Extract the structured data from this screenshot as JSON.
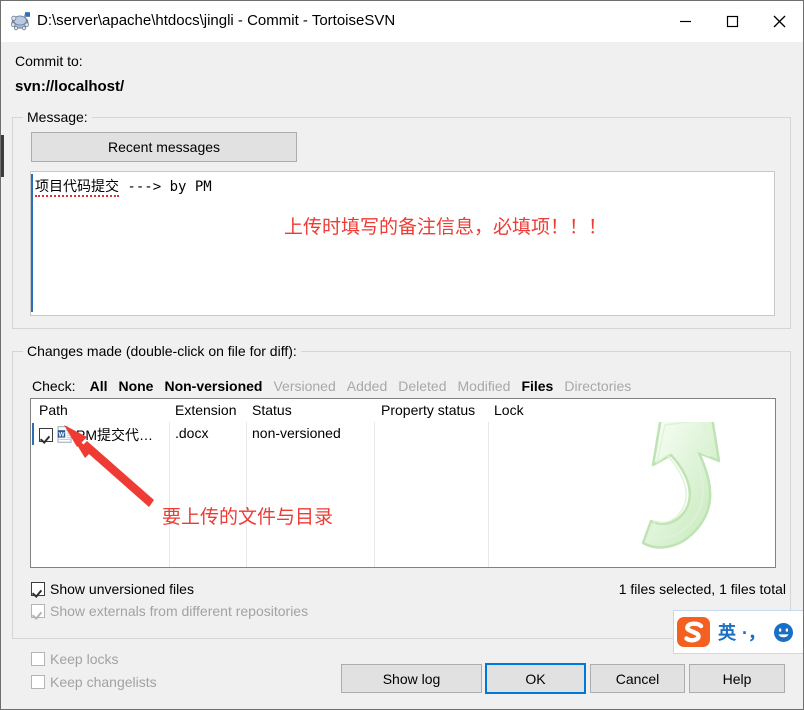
{
  "window": {
    "title": "D:\\server\\apache\\htdocs\\jingli - Commit - TortoiseSVN",
    "icon": "tortoisesvn-turtle-icon",
    "controls": {
      "minimize": "minimize-icon",
      "maximize": "maximize-icon",
      "close": "close-icon"
    },
    "titlebar_bg": "#ffffff",
    "body_bg": "#f0f0f0"
  },
  "commit_to": {
    "label": "Commit to:",
    "url": "svn://localhost/"
  },
  "message_group": {
    "legend": "Message:",
    "recent_messages_button": "Recent messages",
    "text": "项目代码提交 ---> by PM",
    "text_spelled_part": "项目代码提交",
    "text_rest": " ---> by PM",
    "annotation": "上传时填写的备注信息，必填项！！！",
    "annotation_color": "#ee3b33"
  },
  "changes_group": {
    "legend": "Changes made (double-click on file for diff):",
    "check_row": {
      "label": "Check:",
      "items": [
        {
          "label": "All",
          "state": "active"
        },
        {
          "label": "None",
          "state": "active"
        },
        {
          "label": "Non-versioned",
          "state": "active"
        },
        {
          "label": "Versioned",
          "state": "disabled"
        },
        {
          "label": "Added",
          "state": "disabled"
        },
        {
          "label": "Deleted",
          "state": "disabled"
        },
        {
          "label": "Modified",
          "state": "disabled"
        },
        {
          "label": "Files",
          "state": "active"
        },
        {
          "label": "Directories",
          "state": "disabled"
        }
      ]
    },
    "columns": [
      "Path",
      "Extension",
      "Status",
      "Property status",
      "Lock"
    ],
    "rows": [
      {
        "checked": true,
        "icon": "word-document-icon",
        "path": "PM提交代…",
        "extension": ".docx",
        "status": "non-versioned",
        "property_status": "",
        "lock": ""
      }
    ],
    "annotation": "要上传的文件与目录",
    "annotation_color": "#ee3b33",
    "watermark": "commit-arrow-watermark-icon",
    "status_text": "1 files selected, 1 files total",
    "options": [
      {
        "label": "Show unversioned files",
        "checked": true,
        "enabled": true
      },
      {
        "label": "Show externals from different repositories",
        "checked": true,
        "enabled": false
      }
    ]
  },
  "footer": {
    "options": [
      {
        "label": "Keep locks",
        "checked": false,
        "enabled": false
      },
      {
        "label": "Keep changelists",
        "checked": false,
        "enabled": false
      }
    ],
    "buttons": [
      {
        "label": "Show log",
        "focused": false
      },
      {
        "label": "OK",
        "focused": true
      },
      {
        "label": "Cancel",
        "focused": false
      },
      {
        "label": "Help",
        "focused": false
      }
    ],
    "focus_color": "#0078d7"
  },
  "ime": {
    "logo": "sogou-pinyin-logo-icon",
    "mode": "英",
    "punctuation": "·，",
    "smiley": "smiley-face-icon",
    "accent_color": "#1a6fc4",
    "logo_color": "#f4601f"
  }
}
